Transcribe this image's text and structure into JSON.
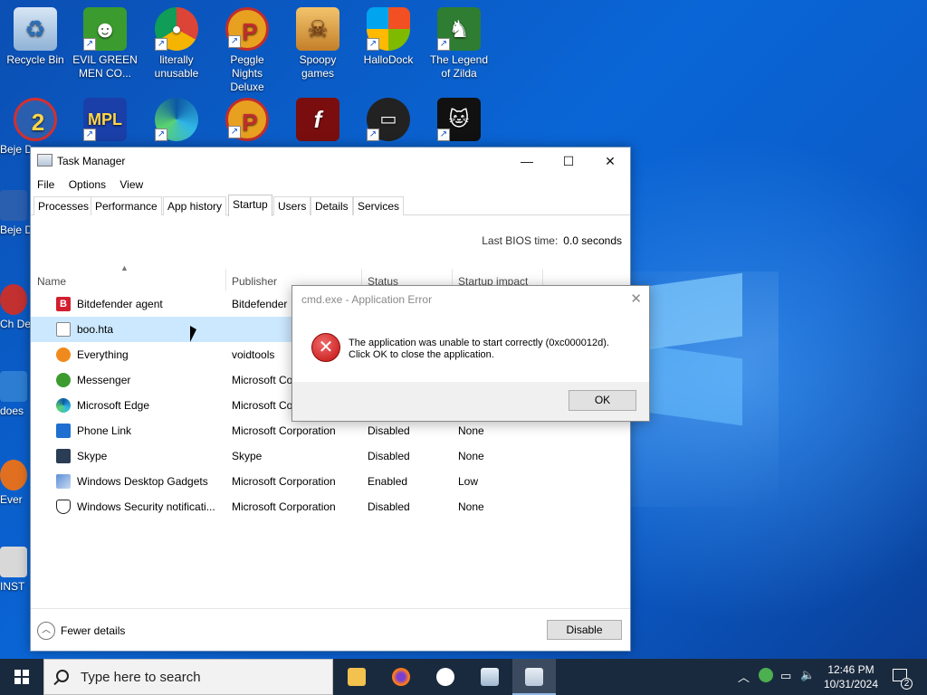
{
  "desktop": {
    "icons": [
      {
        "label": "Recycle Bin"
      },
      {
        "label": "EVIL GREEN MEN CO..."
      },
      {
        "label": "literally unusable"
      },
      {
        "label": "Peggle Nights Deluxe"
      },
      {
        "label": "Spoopy games"
      },
      {
        "label": "HalloDock"
      },
      {
        "label": "The Legend of Zilda"
      }
    ],
    "side_labels": [
      "Beje De",
      "Beje De",
      "Ch De",
      "does",
      "Ever",
      "INST"
    ]
  },
  "taskmgr": {
    "title": "Task Manager",
    "menu": [
      "File",
      "Options",
      "View"
    ],
    "tabs": [
      "Processes",
      "Performance",
      "App history",
      "Startup",
      "Users",
      "Details",
      "Services"
    ],
    "active_tab": "Startup",
    "bios_label": "Last BIOS time:",
    "bios_value": "0.0 seconds",
    "columns": [
      "Name",
      "Publisher",
      "Status",
      "Startup impact"
    ],
    "rows": [
      {
        "name": "Bitdefender agent",
        "publisher": "Bitdefender",
        "status": "",
        "impact": ""
      },
      {
        "name": "boo.hta",
        "publisher": "",
        "status": "",
        "impact": ""
      },
      {
        "name": "Everything",
        "publisher": "voidtools",
        "status": "",
        "impact": ""
      },
      {
        "name": "Messenger",
        "publisher": "Microsoft Co",
        "status": "",
        "impact": ""
      },
      {
        "name": "Microsoft Edge",
        "publisher": "Microsoft Co",
        "status": "",
        "impact": ""
      },
      {
        "name": "Phone Link",
        "publisher": "Microsoft Corporation",
        "status": "Disabled",
        "impact": "None"
      },
      {
        "name": "Skype",
        "publisher": "Skype",
        "status": "Disabled",
        "impact": "None"
      },
      {
        "name": "Windows Desktop Gadgets",
        "publisher": "Microsoft Corporation",
        "status": "Enabled",
        "impact": "Low"
      },
      {
        "name": "Windows Security notificati...",
        "publisher": "Microsoft Corporation",
        "status": "Disabled",
        "impact": "None"
      }
    ],
    "fewer_details": "Fewer details",
    "disable_button": "Disable"
  },
  "error_dialog": {
    "title": "cmd.exe - Application Error",
    "message_line1": "The application was unable to start correctly (0xc000012d).",
    "message_line2": "Click OK to close the application.",
    "ok_button": "OK"
  },
  "taskbar": {
    "search_placeholder": "Type here to search",
    "time": "12:46 PM",
    "date": "10/31/2024",
    "notification_count": "2"
  }
}
